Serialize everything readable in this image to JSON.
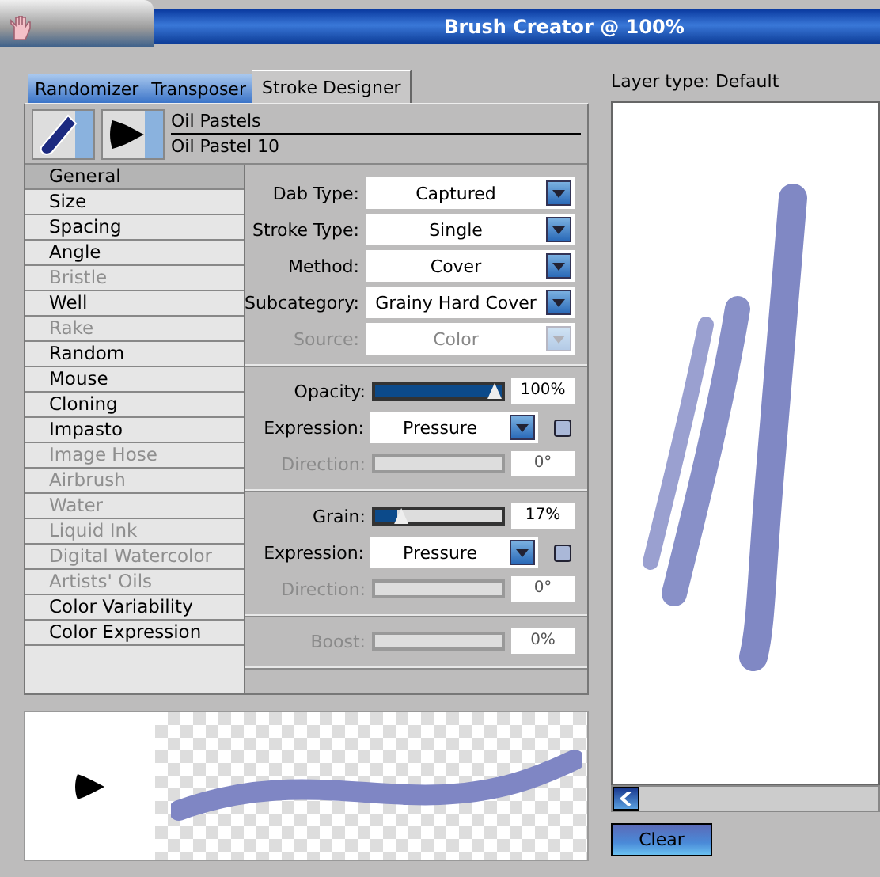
{
  "window": {
    "title": "Brush Creator @ 100%"
  },
  "tabs": [
    {
      "label": "Randomizer",
      "selected": false
    },
    {
      "label": "Transposer",
      "selected": false
    },
    {
      "label": "Stroke Designer",
      "selected": true
    }
  ],
  "brush": {
    "category": "Oil Pastels",
    "variant": "Oil Pastel 10"
  },
  "sidebar": {
    "items": [
      {
        "label": "General",
        "selected": true,
        "disabled": false
      },
      {
        "label": "Size",
        "selected": false,
        "disabled": false
      },
      {
        "label": "Spacing",
        "selected": false,
        "disabled": false
      },
      {
        "label": "Angle",
        "selected": false,
        "disabled": false
      },
      {
        "label": "Bristle",
        "selected": false,
        "disabled": true
      },
      {
        "label": "Well",
        "selected": false,
        "disabled": false
      },
      {
        "label": "Rake",
        "selected": false,
        "disabled": true
      },
      {
        "label": "Random",
        "selected": false,
        "disabled": false
      },
      {
        "label": "Mouse",
        "selected": false,
        "disabled": false
      },
      {
        "label": "Cloning",
        "selected": false,
        "disabled": false
      },
      {
        "label": "Impasto",
        "selected": false,
        "disabled": false
      },
      {
        "label": "Image Hose",
        "selected": false,
        "disabled": true
      },
      {
        "label": "Airbrush",
        "selected": false,
        "disabled": true
      },
      {
        "label": "Water",
        "selected": false,
        "disabled": true
      },
      {
        "label": "Liquid Ink",
        "selected": false,
        "disabled": true
      },
      {
        "label": "Digital Watercolor",
        "selected": false,
        "disabled": true
      },
      {
        "label": "Artists' Oils",
        "selected": false,
        "disabled": true
      },
      {
        "label": "Color Variability",
        "selected": false,
        "disabled": false
      },
      {
        "label": "Color Expression",
        "selected": false,
        "disabled": false
      }
    ]
  },
  "settings": {
    "groups": [
      {
        "rows": [
          {
            "kind": "select",
            "label": "Dab Type:",
            "value": "Captured",
            "disabled": false
          },
          {
            "kind": "select",
            "label": "Stroke Type:",
            "value": "Single",
            "disabled": false
          },
          {
            "kind": "select",
            "label": "Method:",
            "value": "Cover",
            "disabled": false
          },
          {
            "kind": "select",
            "label": "Subcategory:",
            "value": "Grainy Hard Cover",
            "disabled": false
          },
          {
            "kind": "select",
            "label": "Source:",
            "value": "Color",
            "disabled": true
          }
        ]
      },
      {
        "rows": [
          {
            "kind": "slider",
            "label": "Opacity:",
            "level": 1,
            "reading": "100%",
            "disabled": false
          },
          {
            "kind": "expression",
            "label": "Expression:",
            "value": "Pressure",
            "checked": false
          },
          {
            "kind": "slider",
            "label": "Direction:",
            "reading": "0°",
            "disabled": true
          }
        ]
      },
      {
        "rows": [
          {
            "kind": "slider",
            "label": "Grain:",
            "level": 0.17,
            "reading": "17%",
            "disabled": false
          },
          {
            "kind": "expression",
            "label": "Expression:",
            "value": "Pressure",
            "checked": false
          },
          {
            "kind": "slider",
            "label": "Direction:",
            "reading": "0°",
            "disabled": true
          }
        ]
      },
      {
        "rows": [
          {
            "kind": "slider",
            "label": "Boost:",
            "reading": "0%",
            "disabled": true
          }
        ]
      }
    ]
  },
  "canvas": {
    "layer_type": "Layer type: Default"
  },
  "buttons": [
    {
      "label": "Clear"
    }
  ]
}
